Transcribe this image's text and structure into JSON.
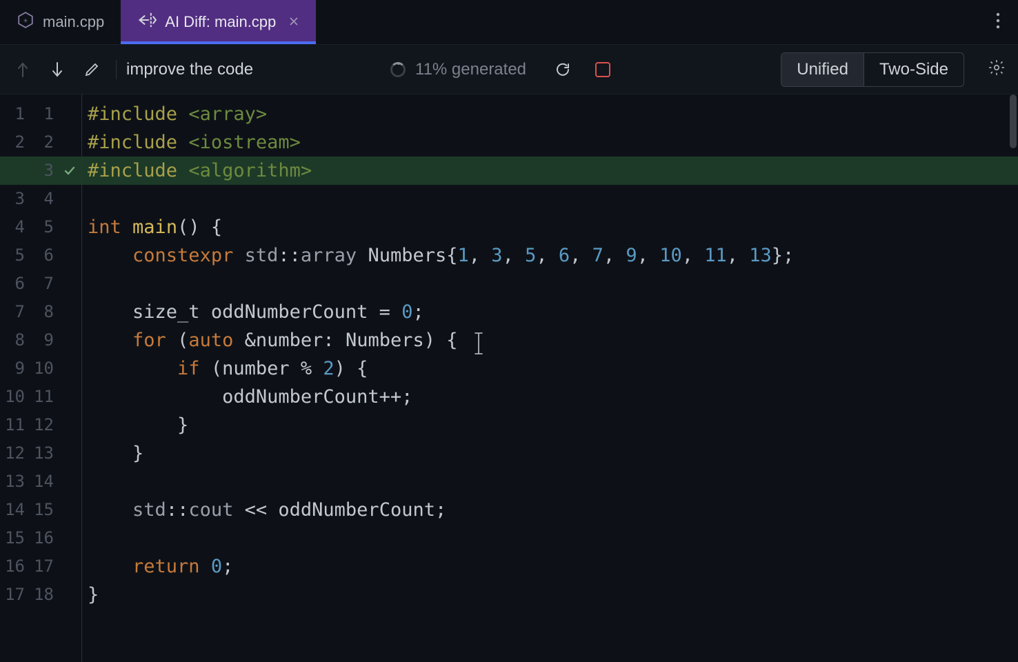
{
  "tabs": [
    {
      "label": "main.cpp",
      "icon": "cpp-file-icon",
      "active": false
    },
    {
      "label": "AI Diff: main.cpp",
      "icon": "ai-diff-icon",
      "active": true
    }
  ],
  "toolbar": {
    "prompt_value": "improve the code",
    "progress_text": "11% generated",
    "view_unified": "Unified",
    "view_twoside": "Two-Side"
  },
  "diff": {
    "lines": [
      {
        "old": "1",
        "new": "1",
        "status": "ctx",
        "tokens": [
          [
            "pp",
            "#include"
          ],
          [
            "punc",
            " "
          ],
          [
            "inc",
            "<array>"
          ]
        ]
      },
      {
        "old": "2",
        "new": "2",
        "status": "ctx",
        "tokens": [
          [
            "pp",
            "#include"
          ],
          [
            "punc",
            " "
          ],
          [
            "inc",
            "<iostream>"
          ]
        ]
      },
      {
        "old": "",
        "new": "3",
        "status": "add",
        "tokens": [
          [
            "pp",
            "#include"
          ],
          [
            "punc",
            " "
          ],
          [
            "inc",
            "<algorithm>"
          ]
        ]
      },
      {
        "old": "3",
        "new": "4",
        "status": "ctx",
        "tokens": []
      },
      {
        "old": "4",
        "new": "5",
        "status": "ctx",
        "tokens": [
          [
            "kw",
            "int"
          ],
          [
            "punc",
            " "
          ],
          [
            "fn",
            "main"
          ],
          [
            "punc",
            "() {"
          ]
        ]
      },
      {
        "old": "5",
        "new": "6",
        "status": "ctx",
        "tokens": [
          [
            "punc",
            "    "
          ],
          [
            "kw",
            "constexpr"
          ],
          [
            "punc",
            " "
          ],
          [
            "ns",
            "std"
          ],
          [
            "punc",
            "::"
          ],
          [
            "ns",
            "array"
          ],
          [
            "punc",
            " "
          ],
          [
            "var",
            "Numbers"
          ],
          [
            "punc",
            "{"
          ],
          [
            "num",
            "1"
          ],
          [
            "punc",
            ", "
          ],
          [
            "num",
            "3"
          ],
          [
            "punc",
            ", "
          ],
          [
            "num",
            "5"
          ],
          [
            "punc",
            ", "
          ],
          [
            "num",
            "6"
          ],
          [
            "punc",
            ", "
          ],
          [
            "num",
            "7"
          ],
          [
            "punc",
            ", "
          ],
          [
            "num",
            "9"
          ],
          [
            "punc",
            ", "
          ],
          [
            "num",
            "10"
          ],
          [
            "punc",
            ", "
          ],
          [
            "num",
            "11"
          ],
          [
            "punc",
            ", "
          ],
          [
            "num",
            "13"
          ],
          [
            "punc",
            "};"
          ]
        ]
      },
      {
        "old": "6",
        "new": "7",
        "status": "ctx",
        "tokens": []
      },
      {
        "old": "7",
        "new": "8",
        "status": "ctx",
        "tokens": [
          [
            "punc",
            "    "
          ],
          [
            "type",
            "size_t"
          ],
          [
            "punc",
            " "
          ],
          [
            "var",
            "oddNumberCount"
          ],
          [
            "punc",
            " = "
          ],
          [
            "num",
            "0"
          ],
          [
            "punc",
            ";"
          ]
        ]
      },
      {
        "old": "8",
        "new": "9",
        "status": "ctx",
        "tokens": [
          [
            "punc",
            "    "
          ],
          [
            "kw",
            "for"
          ],
          [
            "punc",
            " ("
          ],
          [
            "kw",
            "auto"
          ],
          [
            "punc",
            " &"
          ],
          [
            "var",
            "number"
          ],
          [
            "punc",
            ": "
          ],
          [
            "var",
            "Numbers"
          ],
          [
            "punc",
            ") {"
          ]
        ]
      },
      {
        "old": "9",
        "new": "10",
        "status": "ctx",
        "tokens": [
          [
            "punc",
            "        "
          ],
          [
            "kw",
            "if"
          ],
          [
            "punc",
            " ("
          ],
          [
            "var",
            "number"
          ],
          [
            "punc",
            " % "
          ],
          [
            "num",
            "2"
          ],
          [
            "punc",
            ") {"
          ]
        ]
      },
      {
        "old": "10",
        "new": "11",
        "status": "ctx",
        "tokens": [
          [
            "punc",
            "            "
          ],
          [
            "var",
            "oddNumberCount"
          ],
          [
            "punc",
            "++;"
          ]
        ]
      },
      {
        "old": "11",
        "new": "12",
        "status": "ctx",
        "tokens": [
          [
            "punc",
            "        }"
          ]
        ]
      },
      {
        "old": "12",
        "new": "13",
        "status": "ctx",
        "tokens": [
          [
            "punc",
            "    }"
          ]
        ]
      },
      {
        "old": "13",
        "new": "14",
        "status": "ctx",
        "tokens": []
      },
      {
        "old": "14",
        "new": "15",
        "status": "ctx",
        "tokens": [
          [
            "punc",
            "    "
          ],
          [
            "ns",
            "std"
          ],
          [
            "punc",
            "::"
          ],
          [
            "ns",
            "cout"
          ],
          [
            "punc",
            " << "
          ],
          [
            "var",
            "oddNumberCount"
          ],
          [
            "punc",
            ";"
          ]
        ]
      },
      {
        "old": "15",
        "new": "16",
        "status": "ctx",
        "tokens": []
      },
      {
        "old": "16",
        "new": "17",
        "status": "ctx",
        "tokens": [
          [
            "punc",
            "    "
          ],
          [
            "kw",
            "return"
          ],
          [
            "punc",
            " "
          ],
          [
            "num",
            "0"
          ],
          [
            "punc",
            ";"
          ]
        ]
      },
      {
        "old": "17",
        "new": "18",
        "status": "ctx",
        "tokens": [
          [
            "punc",
            "}"
          ]
        ]
      }
    ]
  },
  "colors": {
    "added_bg": "#1d3a28",
    "accent_tab": "#522e82",
    "accent_underline": "#4b6df0"
  }
}
